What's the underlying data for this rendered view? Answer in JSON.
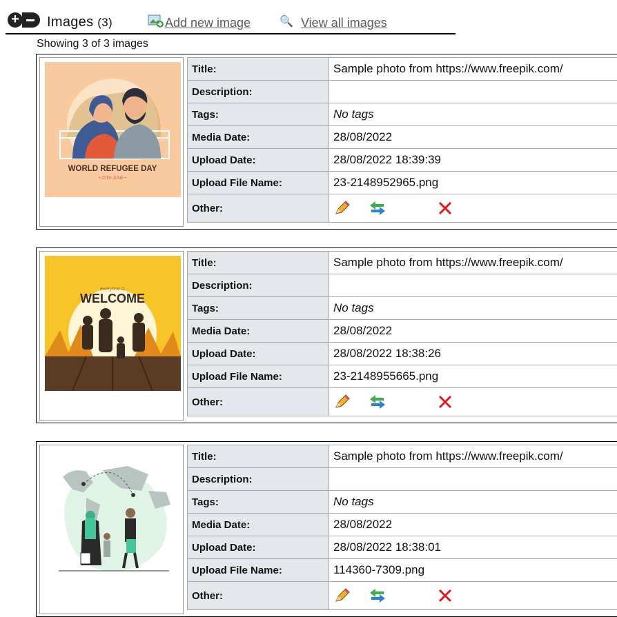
{
  "header": {
    "title": "Images",
    "count": "(3)",
    "add_label": "Add new image",
    "view_label": "View all images"
  },
  "showing_text": "Showing 3 of 3 images",
  "labels": {
    "title": "Title:",
    "description": "Description:",
    "tags": "Tags:",
    "media_date": "Media Date:",
    "upload_date": "Upload Date:",
    "upload_file_name": "Upload File Name:",
    "other": "Other:"
  },
  "images": [
    {
      "title": "Sample photo from https://www.freepik.com/",
      "description": "",
      "tags": "No tags",
      "media_date": "28/08/2022",
      "upload_date": "28/08/2022 18:39:39",
      "file_name": "23-2148952965.png",
      "thumb_text": "WORLD REFUGEE DAY",
      "thumb_sub": "• 20TH JUNE •"
    },
    {
      "title": "Sample photo from https://www.freepik.com/",
      "description": "",
      "tags": "No tags",
      "media_date": "28/08/2022",
      "upload_date": "28/08/2022 18:38:26",
      "file_name": "23-2148955665.png",
      "thumb_text": "WELCOME",
      "thumb_sub": "everyone is"
    },
    {
      "title": "Sample photo from https://www.freepik.com/",
      "description": "",
      "tags": "No tags",
      "media_date": "28/08/2022",
      "upload_date": "28/08/2022 18:38:01",
      "file_name": "114360-7309.png"
    }
  ],
  "colors": {
    "link": "#5a5a5a",
    "label_bg": "#e4e7ec",
    "delete": "#e3161b",
    "accent": "#f9c9a0"
  },
  "icons": {
    "edit": "pencil-icon",
    "move": "swap-arrows-icon",
    "delete": "delete-x-icon",
    "add": "add-image-icon",
    "view": "magnifier-icon"
  }
}
